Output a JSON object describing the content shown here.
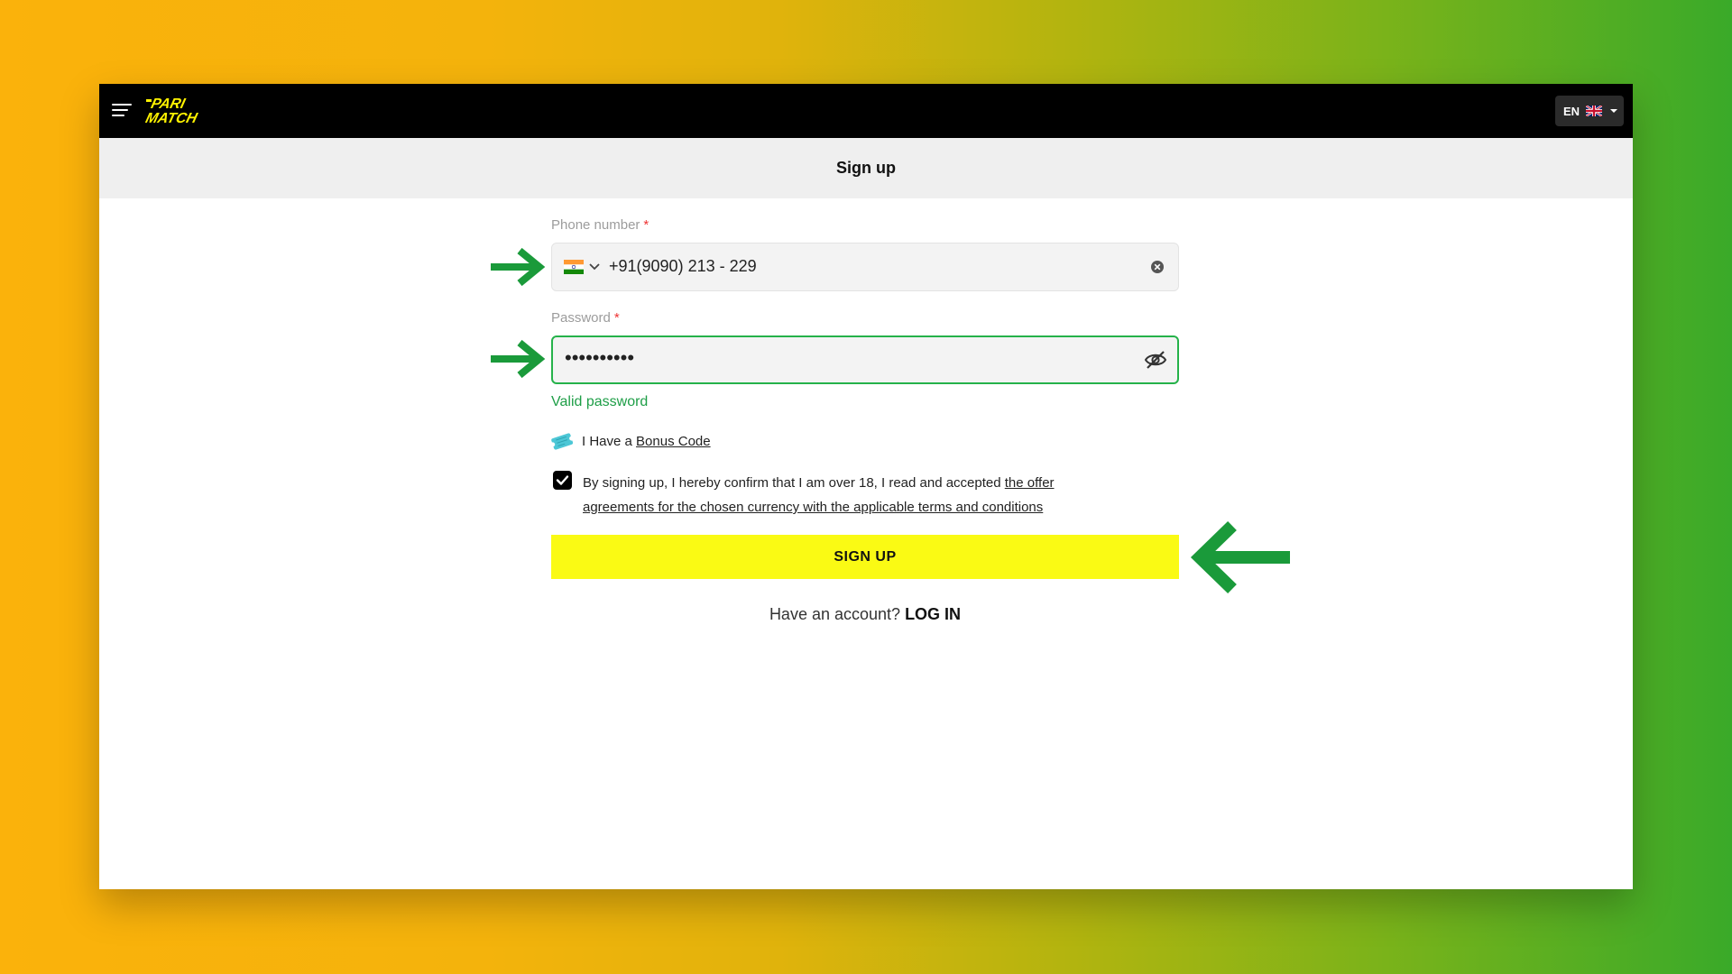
{
  "header": {
    "logo_alt": "PARI MATCH",
    "language": "EN"
  },
  "page": {
    "title": "Sign up"
  },
  "form": {
    "phone_label": "Phone number",
    "required_mark": "*",
    "phone_value": "+91(9090) 213 - 229",
    "password_label": "Password",
    "password_value": "••••••••••",
    "password_status": "Valid password",
    "bonus_prefix": "I Have a",
    "bonus_link": "Bonus Code",
    "agree_text": "By signing up, I hereby confirm that I am over 18, I read and accepted",
    "agree_link": "the offer agreements for the chosen currency with the applicable terms and conditions",
    "agree_checked": true,
    "signup_button": "SIGN UP",
    "login_prompt": "Have an account?",
    "login_link": "LOG IN"
  },
  "colors": {
    "accent_yellow": "#fafa14",
    "valid_green": "#1e9e47",
    "arrow_green": "#1a9a3a"
  },
  "icons": {
    "menu": "menu-icon",
    "flag": "india-flag-icon",
    "uk_flag": "uk-flag-icon",
    "clear": "clear-icon",
    "eye": "eye-off-icon",
    "bonus": "ticket-icon"
  }
}
